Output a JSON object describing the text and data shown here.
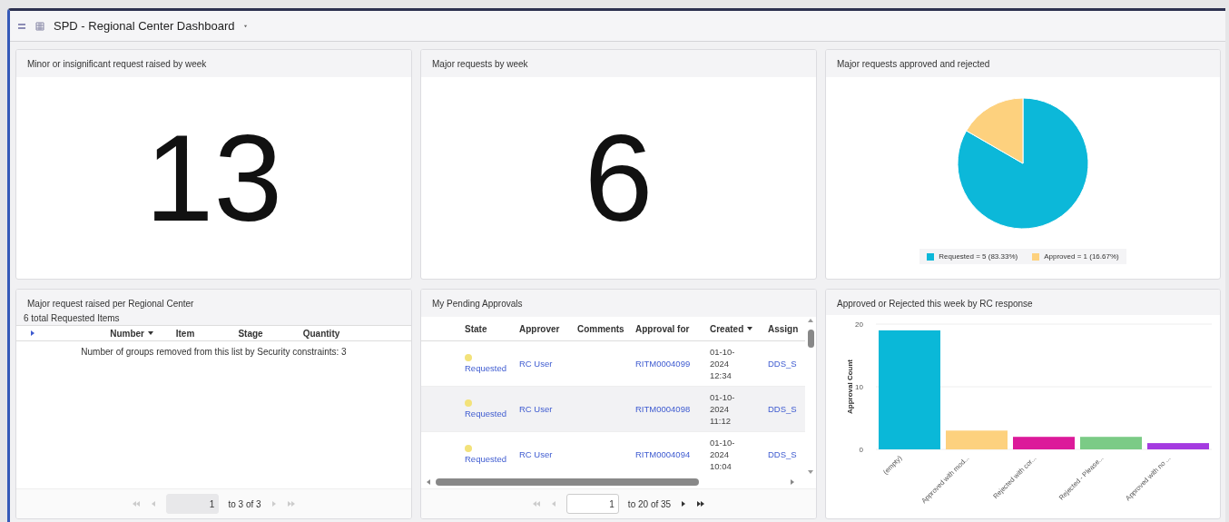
{
  "header": {
    "title": "SPD - Regional Center Dashboard"
  },
  "widgets": [
    {
      "kind": "score",
      "title": "Minor or insignificant request raised by week",
      "value": "13"
    },
    {
      "kind": "score",
      "title": "Major requests by week",
      "value": "6"
    },
    {
      "kind": "chart",
      "title": "Major requests approved and rejected",
      "chart_data": {
        "type": "pie",
        "categories": [
          "Requested",
          "Approved"
        ],
        "values": [
          83.33,
          16.67
        ],
        "colors": [
          "#0cb8d9",
          "#fdd17e"
        ]
      },
      "legend": [
        {
          "detail": "= 5 (83.33%)",
          "color": "#0cb8d9"
        },
        {
          "detail": "= 1 (16.67%)",
          "color": "#fdd17e"
        }
      ]
    },
    {
      "kind": "list",
      "title": "Major request raised per Regional Center",
      "summary": "6 total Requested Items",
      "columns": [
        {
          "label": "Number",
          "sorted": true
        },
        {
          "label": "Item",
          "sorted": false
        },
        {
          "label": "Stage",
          "sorted": false
        },
        {
          "label": "Quantity",
          "sorted": false
        }
      ],
      "message": "Number of groups removed from this list by Security constraints: 3",
      "pager": {
        "page": "1",
        "range": "to 3 of 3",
        "can_next": false
      }
    },
    {
      "kind": "approvals",
      "title": "My Pending Approvals",
      "columns": [
        {
          "label": "State",
          "sorted": false
        },
        {
          "label": "Approver",
          "sorted": false
        },
        {
          "label": "Comments",
          "sorted": false
        },
        {
          "label": "Approval for",
          "sorted": false
        },
        {
          "label": "Created",
          "sorted": true
        },
        {
          "label": "Assign",
          "sorted": false
        }
      ],
      "rows": [
        {
          "state": "Requested",
          "color": "#f3e27a",
          "approver": "RC User",
          "approval_for": "RITM0004099",
          "created": "01-10-2024 12:34",
          "assign": "DDS_S"
        },
        {
          "state": "Requested",
          "color": "#f3e27a",
          "approver": "RC User",
          "approval_for": "RITM0004098",
          "created": "01-10-2024 11:12",
          "assign": "DDS_S"
        },
        {
          "state": "Requested",
          "color": "#f3e27a",
          "approver": "RC User",
          "approval_for": "RITM0004094",
          "created": "01-10-2024 10:04",
          "assign": "DDS_S"
        }
      ],
      "pager": {
        "page": "1",
        "range": "to 20 of 35",
        "can_next": true
      }
    },
    {
      "kind": "chart",
      "title": "Approved or Rejected this week by RC response",
      "chart_data": {
        "type": "bar",
        "ylabel": "Approval Count",
        "categories": [
          "(empty)",
          "Approved with mod...",
          "Rejected with cor...",
          "Rejected - Please...",
          "Approved with no ..."
        ],
        "values": [
          19,
          3,
          2,
          2,
          1
        ],
        "colors": [
          "#0ab8d8",
          "#fdd17e",
          "#dc1a9a",
          "#7bcb86",
          "#a43be0"
        ],
        "ylim": [
          0,
          20
        ],
        "yticks": [
          0,
          10,
          20
        ]
      }
    }
  ]
}
